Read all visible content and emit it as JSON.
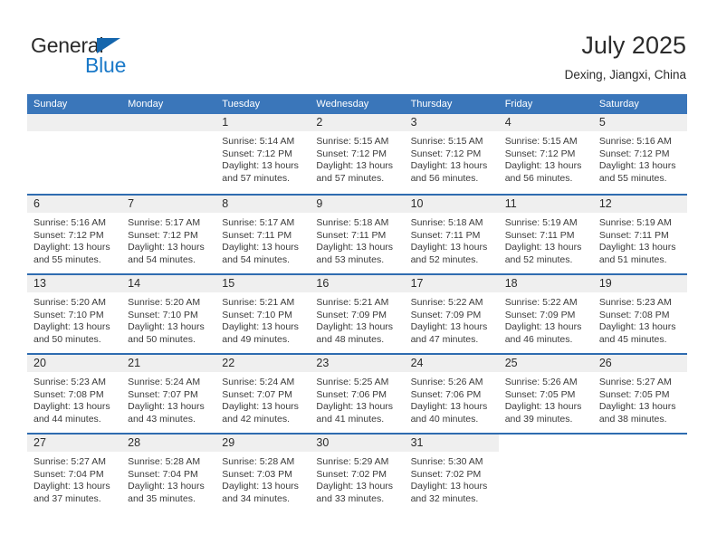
{
  "brand": {
    "line1": "General",
    "line2": "Blue",
    "triangle_color": "#1566ad",
    "blue_text_color": "#1a79c8"
  },
  "header": {
    "title": "July 2025",
    "subtitle": "Dexing, Jiangxi, China"
  },
  "theme": {
    "header_row_bg": "#3a76ba",
    "row_separator": "#2f6cb0",
    "day_number_band": "#efefef"
  },
  "calendar": {
    "day_headers": [
      "Sunday",
      "Monday",
      "Tuesday",
      "Wednesday",
      "Thursday",
      "Friday",
      "Saturday"
    ],
    "weeks": [
      [
        {
          "day": "",
          "sunrise": "",
          "sunset": "",
          "daylight": ""
        },
        {
          "day": "",
          "sunrise": "",
          "sunset": "",
          "daylight": ""
        },
        {
          "day": "1",
          "sunrise": "Sunrise: 5:14 AM",
          "sunset": "Sunset: 7:12 PM",
          "daylight": "Daylight: 13 hours and 57 minutes."
        },
        {
          "day": "2",
          "sunrise": "Sunrise: 5:15 AM",
          "sunset": "Sunset: 7:12 PM",
          "daylight": "Daylight: 13 hours and 57 minutes."
        },
        {
          "day": "3",
          "sunrise": "Sunrise: 5:15 AM",
          "sunset": "Sunset: 7:12 PM",
          "daylight": "Daylight: 13 hours and 56 minutes."
        },
        {
          "day": "4",
          "sunrise": "Sunrise: 5:15 AM",
          "sunset": "Sunset: 7:12 PM",
          "daylight": "Daylight: 13 hours and 56 minutes."
        },
        {
          "day": "5",
          "sunrise": "Sunrise: 5:16 AM",
          "sunset": "Sunset: 7:12 PM",
          "daylight": "Daylight: 13 hours and 55 minutes."
        }
      ],
      [
        {
          "day": "6",
          "sunrise": "Sunrise: 5:16 AM",
          "sunset": "Sunset: 7:12 PM",
          "daylight": "Daylight: 13 hours and 55 minutes."
        },
        {
          "day": "7",
          "sunrise": "Sunrise: 5:17 AM",
          "sunset": "Sunset: 7:12 PM",
          "daylight": "Daylight: 13 hours and 54 minutes."
        },
        {
          "day": "8",
          "sunrise": "Sunrise: 5:17 AM",
          "sunset": "Sunset: 7:11 PM",
          "daylight": "Daylight: 13 hours and 54 minutes."
        },
        {
          "day": "9",
          "sunrise": "Sunrise: 5:18 AM",
          "sunset": "Sunset: 7:11 PM",
          "daylight": "Daylight: 13 hours and 53 minutes."
        },
        {
          "day": "10",
          "sunrise": "Sunrise: 5:18 AM",
          "sunset": "Sunset: 7:11 PM",
          "daylight": "Daylight: 13 hours and 52 minutes."
        },
        {
          "day": "11",
          "sunrise": "Sunrise: 5:19 AM",
          "sunset": "Sunset: 7:11 PM",
          "daylight": "Daylight: 13 hours and 52 minutes."
        },
        {
          "day": "12",
          "sunrise": "Sunrise: 5:19 AM",
          "sunset": "Sunset: 7:11 PM",
          "daylight": "Daylight: 13 hours and 51 minutes."
        }
      ],
      [
        {
          "day": "13",
          "sunrise": "Sunrise: 5:20 AM",
          "sunset": "Sunset: 7:10 PM",
          "daylight": "Daylight: 13 hours and 50 minutes."
        },
        {
          "day": "14",
          "sunrise": "Sunrise: 5:20 AM",
          "sunset": "Sunset: 7:10 PM",
          "daylight": "Daylight: 13 hours and 50 minutes."
        },
        {
          "day": "15",
          "sunrise": "Sunrise: 5:21 AM",
          "sunset": "Sunset: 7:10 PM",
          "daylight": "Daylight: 13 hours and 49 minutes."
        },
        {
          "day": "16",
          "sunrise": "Sunrise: 5:21 AM",
          "sunset": "Sunset: 7:09 PM",
          "daylight": "Daylight: 13 hours and 48 minutes."
        },
        {
          "day": "17",
          "sunrise": "Sunrise: 5:22 AM",
          "sunset": "Sunset: 7:09 PM",
          "daylight": "Daylight: 13 hours and 47 minutes."
        },
        {
          "day": "18",
          "sunrise": "Sunrise: 5:22 AM",
          "sunset": "Sunset: 7:09 PM",
          "daylight": "Daylight: 13 hours and 46 minutes."
        },
        {
          "day": "19",
          "sunrise": "Sunrise: 5:23 AM",
          "sunset": "Sunset: 7:08 PM",
          "daylight": "Daylight: 13 hours and 45 minutes."
        }
      ],
      [
        {
          "day": "20",
          "sunrise": "Sunrise: 5:23 AM",
          "sunset": "Sunset: 7:08 PM",
          "daylight": "Daylight: 13 hours and 44 minutes."
        },
        {
          "day": "21",
          "sunrise": "Sunrise: 5:24 AM",
          "sunset": "Sunset: 7:07 PM",
          "daylight": "Daylight: 13 hours and 43 minutes."
        },
        {
          "day": "22",
          "sunrise": "Sunrise: 5:24 AM",
          "sunset": "Sunset: 7:07 PM",
          "daylight": "Daylight: 13 hours and 42 minutes."
        },
        {
          "day": "23",
          "sunrise": "Sunrise: 5:25 AM",
          "sunset": "Sunset: 7:06 PM",
          "daylight": "Daylight: 13 hours and 41 minutes."
        },
        {
          "day": "24",
          "sunrise": "Sunrise: 5:26 AM",
          "sunset": "Sunset: 7:06 PM",
          "daylight": "Daylight: 13 hours and 40 minutes."
        },
        {
          "day": "25",
          "sunrise": "Sunrise: 5:26 AM",
          "sunset": "Sunset: 7:05 PM",
          "daylight": "Daylight: 13 hours and 39 minutes."
        },
        {
          "day": "26",
          "sunrise": "Sunrise: 5:27 AM",
          "sunset": "Sunset: 7:05 PM",
          "daylight": "Daylight: 13 hours and 38 minutes."
        }
      ],
      [
        {
          "day": "27",
          "sunrise": "Sunrise: 5:27 AM",
          "sunset": "Sunset: 7:04 PM",
          "daylight": "Daylight: 13 hours and 37 minutes."
        },
        {
          "day": "28",
          "sunrise": "Sunrise: 5:28 AM",
          "sunset": "Sunset: 7:04 PM",
          "daylight": "Daylight: 13 hours and 35 minutes."
        },
        {
          "day": "29",
          "sunrise": "Sunrise: 5:28 AM",
          "sunset": "Sunset: 7:03 PM",
          "daylight": "Daylight: 13 hours and 34 minutes."
        },
        {
          "day": "30",
          "sunrise": "Sunrise: 5:29 AM",
          "sunset": "Sunset: 7:02 PM",
          "daylight": "Daylight: 13 hours and 33 minutes."
        },
        {
          "day": "31",
          "sunrise": "Sunrise: 5:30 AM",
          "sunset": "Sunset: 7:02 PM",
          "daylight": "Daylight: 13 hours and 32 minutes."
        },
        {
          "day": "",
          "sunrise": "",
          "sunset": "",
          "daylight": ""
        },
        {
          "day": "",
          "sunrise": "",
          "sunset": "",
          "daylight": ""
        }
      ]
    ]
  }
}
